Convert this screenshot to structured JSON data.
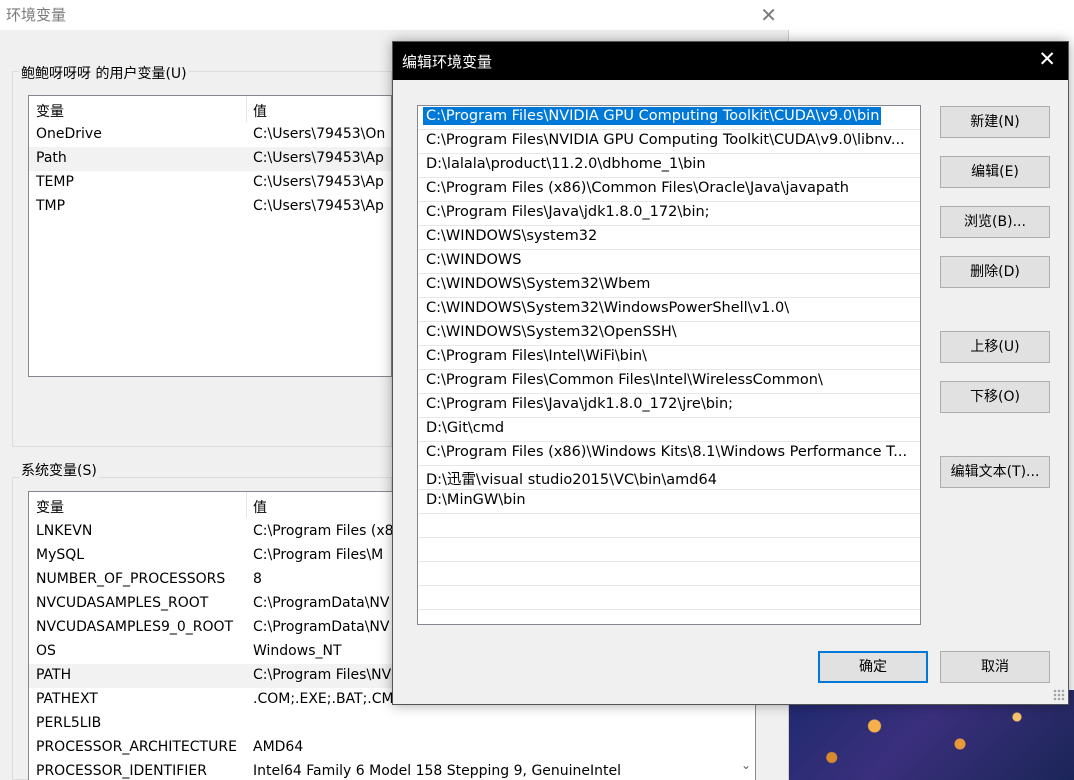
{
  "main_window": {
    "title": "环境变量",
    "close_glyph": "✕",
    "user_vars": {
      "label": "鲍鲍呀呀呀 的用户变量(U)",
      "col_var": "变量",
      "col_val": "值",
      "rows": [
        {
          "name": "OneDrive",
          "value": "C:\\Users\\79453\\On"
        },
        {
          "name": "Path",
          "value": "C:\\Users\\79453\\Ap"
        },
        {
          "name": "TEMP",
          "value": "C:\\Users\\79453\\Ap"
        },
        {
          "name": "TMP",
          "value": "C:\\Users\\79453\\Ap"
        }
      ]
    },
    "system_vars": {
      "label": "系统变量(S)",
      "col_var": "变量",
      "col_val": "值",
      "rows": [
        {
          "name": "LNKEVN",
          "value": "C:\\Program Files (x8"
        },
        {
          "name": "MySQL",
          "value": "C:\\Program Files\\M"
        },
        {
          "name": "NUMBER_OF_PROCESSORS",
          "value": "8"
        },
        {
          "name": "NVCUDASAMPLES_ROOT",
          "value": "C:\\ProgramData\\NV"
        },
        {
          "name": "NVCUDASAMPLES9_0_ROOT",
          "value": "C:\\ProgramData\\NV"
        },
        {
          "name": "OS",
          "value": "Windows_NT"
        },
        {
          "name": "PATH",
          "value": "C:\\Program Files\\NV"
        },
        {
          "name": "PATHEXT",
          "value": ".COM;.EXE;.BAT;.CM"
        },
        {
          "name": "PERL5LIB",
          "value": ""
        },
        {
          "name": "PROCESSOR_ARCHITECTURE",
          "value": "AMD64"
        },
        {
          "name": "PROCESSOR_IDENTIFIER",
          "value": "Intel64 Family 6 Model 158 Stepping 9, GenuineIntel"
        }
      ],
      "scroll_glyph": "⌄"
    }
  },
  "dialog": {
    "title": "编辑环境变量",
    "close_glyph": "✕",
    "paths": [
      "C:\\Program Files\\NVIDIA GPU Computing Toolkit\\CUDA\\v9.0\\bin",
      "C:\\Program Files\\NVIDIA GPU Computing Toolkit\\CUDA\\v9.0\\libnv...",
      "D:\\lalala\\product\\11.2.0\\dbhome_1\\bin",
      "C:\\Program Files (x86)\\Common Files\\Oracle\\Java\\javapath",
      "C:\\Program Files\\Java\\jdk1.8.0_172\\bin;",
      "C:\\WINDOWS\\system32",
      "C:\\WINDOWS",
      "C:\\WINDOWS\\System32\\Wbem",
      "C:\\WINDOWS\\System32\\WindowsPowerShell\\v1.0\\",
      "C:\\WINDOWS\\System32\\OpenSSH\\",
      "C:\\Program Files\\Intel\\WiFi\\bin\\",
      "C:\\Program Files\\Common Files\\Intel\\WirelessCommon\\",
      "C:\\Program Files\\Java\\jdk1.8.0_172\\jre\\bin;",
      "D:\\Git\\cmd",
      "C:\\Program Files (x86)\\Windows Kits\\8.1\\Windows Performance T...",
      "D:\\迅雷\\visual studio2015\\VC\\bin\\amd64",
      "D:\\MinGW\\bin"
    ],
    "selected_index": 0,
    "buttons": {
      "new": "新建(N)",
      "edit": "编辑(E)",
      "browse": "浏览(B)...",
      "delete": "删除(D)",
      "move_up": "上移(U)",
      "move_down": "下移(O)",
      "edit_text": "编辑文本(T)...",
      "ok": "确定",
      "cancel": "取消"
    }
  }
}
